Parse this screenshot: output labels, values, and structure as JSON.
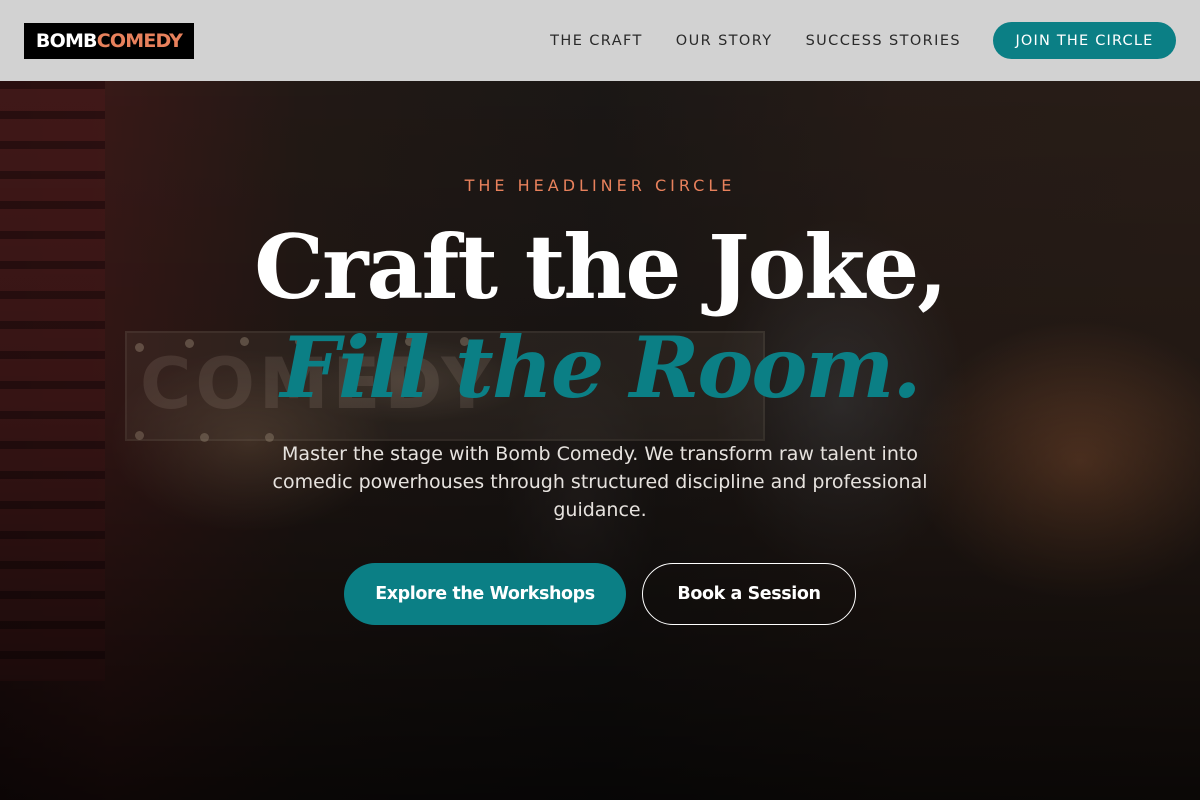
{
  "brand": {
    "logo_word_1": "BOMB",
    "logo_word_2": "COMEDY",
    "accent_color": "#e8815c",
    "teal_color": "#0b7f85"
  },
  "nav": {
    "items": [
      {
        "label": "THE CRAFT"
      },
      {
        "label": "OUR STORY"
      },
      {
        "label": "SUCCESS STORIES"
      }
    ],
    "cta_label": "JOIN THE CIRCLE"
  },
  "hero": {
    "eyebrow": "THE HEADLINER CIRCLE",
    "headline_line_1": "Craft the Joke,",
    "headline_line_2": "Fill the Room.",
    "description": "Master the stage with Bomb Comedy. We transform raw talent into comedic powerhouses through structured discipline and professional guidance.",
    "primary_button": "Explore the Workshops",
    "secondary_button": "Book a Session"
  }
}
